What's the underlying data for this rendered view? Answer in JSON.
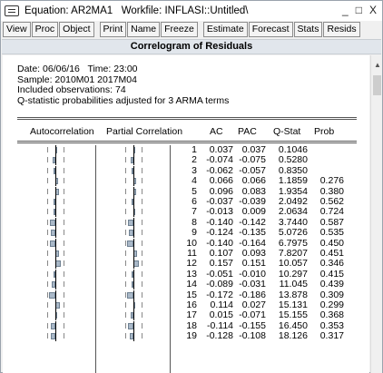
{
  "window": {
    "title": "Equation: AR2MA1   Workfile: INFLASI::Untitled\\",
    "controls": [
      "_",
      "□",
      "X"
    ]
  },
  "toolbar": {
    "group1": [
      "View",
      "Proc",
      "Object"
    ],
    "group2": [
      "Print",
      "Name",
      "Freeze"
    ],
    "group3": [
      "Estimate",
      "Forecast",
      "Stats",
      "Resids"
    ]
  },
  "view_title": "Correlogram of Residuals",
  "header": {
    "line1": "Date: 06/06/16   Time: 23:00",
    "line2": "Sample: 2010M01 2017M04",
    "line3": "Included observations: 74",
    "line4": "Q-statistic probabilities adjusted for 3 ARMA terms"
  },
  "columns": {
    "autocorrelation": "Autocorrelation",
    "partial": "Partial Correlation",
    "ac": "AC",
    "pac": "PAC",
    "qstat": "Q-Stat",
    "prob": "Prob"
  },
  "rows": [
    {
      "lag": "1",
      "ac": "0.037",
      "pac": "0.037",
      "q": "0.1046",
      "prob": ""
    },
    {
      "lag": "2",
      "ac": "-0.074",
      "pac": "-0.075",
      "q": "0.5280",
      "prob": ""
    },
    {
      "lag": "3",
      "ac": "-0.062",
      "pac": "-0.057",
      "q": "0.8350",
      "prob": ""
    },
    {
      "lag": "4",
      "ac": "0.066",
      "pac": "0.066",
      "q": "1.1859",
      "prob": "0.276"
    },
    {
      "lag": "5",
      "ac": "0.096",
      "pac": "0.083",
      "q": "1.9354",
      "prob": "0.380"
    },
    {
      "lag": "6",
      "ac": "-0.037",
      "pac": "-0.039",
      "q": "2.0492",
      "prob": "0.562"
    },
    {
      "lag": "7",
      "ac": "-0.013",
      "pac": "0.009",
      "q": "2.0634",
      "prob": "0.724"
    },
    {
      "lag": "8",
      "ac": "-0.140",
      "pac": "-0.142",
      "q": "3.7440",
      "prob": "0.587"
    },
    {
      "lag": "9",
      "ac": "-0.124",
      "pac": "-0.135",
      "q": "5.0726",
      "prob": "0.535"
    },
    {
      "lag": "10",
      "ac": "-0.140",
      "pac": "-0.164",
      "q": "6.7975",
      "prob": "0.450"
    },
    {
      "lag": "11",
      "ac": "0.107",
      "pac": "0.093",
      "q": "7.8207",
      "prob": "0.451"
    },
    {
      "lag": "12",
      "ac": "0.157",
      "pac": "0.151",
      "q": "10.057",
      "prob": "0.346"
    },
    {
      "lag": "13",
      "ac": "-0.051",
      "pac": "-0.010",
      "q": "10.297",
      "prob": "0.415"
    },
    {
      "lag": "14",
      "ac": "-0.089",
      "pac": "-0.031",
      "q": "11.045",
      "prob": "0.439"
    },
    {
      "lag": "15",
      "ac": "-0.172",
      "pac": "-0.186",
      "q": "13.878",
      "prob": "0.309"
    },
    {
      "lag": "16",
      "ac": "0.114",
      "pac": "0.027",
      "q": "15.131",
      "prob": "0.299"
    },
    {
      "lag": "17",
      "ac": "0.015",
      "pac": "-0.071",
      "q": "15.155",
      "prob": "0.368"
    },
    {
      "lag": "18",
      "ac": "-0.114",
      "pac": "-0.155",
      "q": "16.450",
      "prob": "0.353"
    },
    {
      "lag": "19",
      "ac": "-0.128",
      "pac": "-0.108",
      "q": "18.126",
      "prob": "0.317"
    }
  ],
  "colors": {
    "bar_fill": "#a9b8c8",
    "bar_border": "#6f8192",
    "view_title_bg": "#e1e6ec"
  }
}
